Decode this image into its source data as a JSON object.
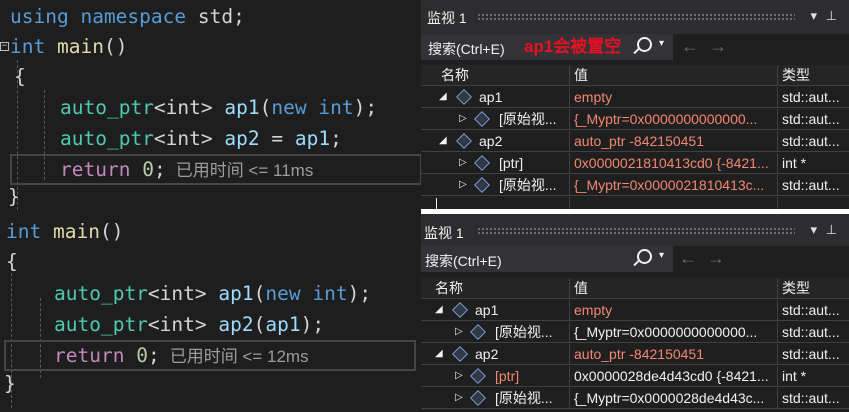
{
  "editor1": {
    "lines": [
      {
        "kw1": "using",
        "kw2": "namespace",
        "id": "std",
        "end": ";"
      },
      {
        "type": "int",
        "fn": "main",
        "parens": "()"
      },
      {
        "brace": "{"
      },
      {
        "type": "auto_ptr",
        "targ": "<int>",
        "var": "ap1",
        "open": "(",
        "kwnew": "new",
        "intkw": "int",
        "close": ");"
      },
      {
        "type": "auto_ptr",
        "targ": "<int>",
        "var": "ap2",
        "eq": " = ",
        "val": "ap1",
        "end": ";"
      },
      {
        "ret": "return",
        "num": "0",
        "end": ";",
        "elapsed": "已用时间 <= 11ms"
      },
      {
        "brace": "}"
      }
    ]
  },
  "editor2": {
    "lines": [
      {
        "type": "int",
        "fn": "main",
        "parens": "()"
      },
      {
        "brace": "{"
      },
      {
        "type": "auto_ptr",
        "targ": "<int>",
        "var": "ap1",
        "open": "(",
        "kwnew": "new",
        "intkw": "int",
        "close": ");"
      },
      {
        "type": "auto_ptr",
        "targ": "<int>",
        "var": "ap2",
        "open": "(",
        "arg": "ap1",
        "close": ");"
      },
      {
        "ret": "return",
        "num": "0",
        "end": ";",
        "elapsed": "已用时间 <= 12ms"
      },
      {
        "brace": "}"
      }
    ]
  },
  "watch1": {
    "title": "监视 1",
    "search_label": "搜索(Ctrl+E)",
    "annotation": "ap1会被置空",
    "headers": {
      "name": "名称",
      "value": "值",
      "type": "类型"
    },
    "rows": [
      {
        "name": "ap1",
        "value": "empty",
        "type": "std::aut..."
      },
      {
        "name": "[原始视...",
        "value": "{_Myptr=0x0000000000000...",
        "type": "std::aut..."
      },
      {
        "name": "ap2",
        "value": "auto_ptr -842150451",
        "type": "std::aut..."
      },
      {
        "name": "[ptr]",
        "value": "0x0000021810413cd0 {-8421...",
        "type": "int *"
      },
      {
        "name": "[原始视...",
        "value": "{_Myptr=0x0000021810413c...",
        "type": "std::aut..."
      }
    ]
  },
  "watch2": {
    "title": "监视 1",
    "search_label": "搜索(Ctrl+E)",
    "headers": {
      "name": "名称",
      "value": "值",
      "type": "类型"
    },
    "rows": [
      {
        "name": "ap1",
        "value": "empty",
        "type": "std::aut..."
      },
      {
        "name": "[原始视...",
        "value": "{_Myptr=0x0000000000000...",
        "type": "std::aut..."
      },
      {
        "name": "ap2",
        "value": "auto_ptr -842150451",
        "type": "std::aut..."
      },
      {
        "name": "[ptr]",
        "value": "0x0000028de4d43cd0 {-8421...",
        "type": "int *"
      },
      {
        "name": "[原始视...",
        "value": "{_Myptr=0x0000028de4d43c...",
        "type": "std::aut..."
      }
    ]
  },
  "icons": {
    "pin": "pin-icon",
    "dropdown": "dropdown-arrow-icon",
    "search": "search-icon",
    "back": "back-arrow-icon",
    "forward": "forward-arrow-icon"
  },
  "colors": {
    "keyword": "#569cd6",
    "function": "#dcdcaa",
    "type": "#4ec9b0",
    "control": "#c586c0",
    "number": "#b5cea8",
    "variable": "#9cdcfe",
    "annotation": "#e81123",
    "value_changed": "#f48771"
  }
}
